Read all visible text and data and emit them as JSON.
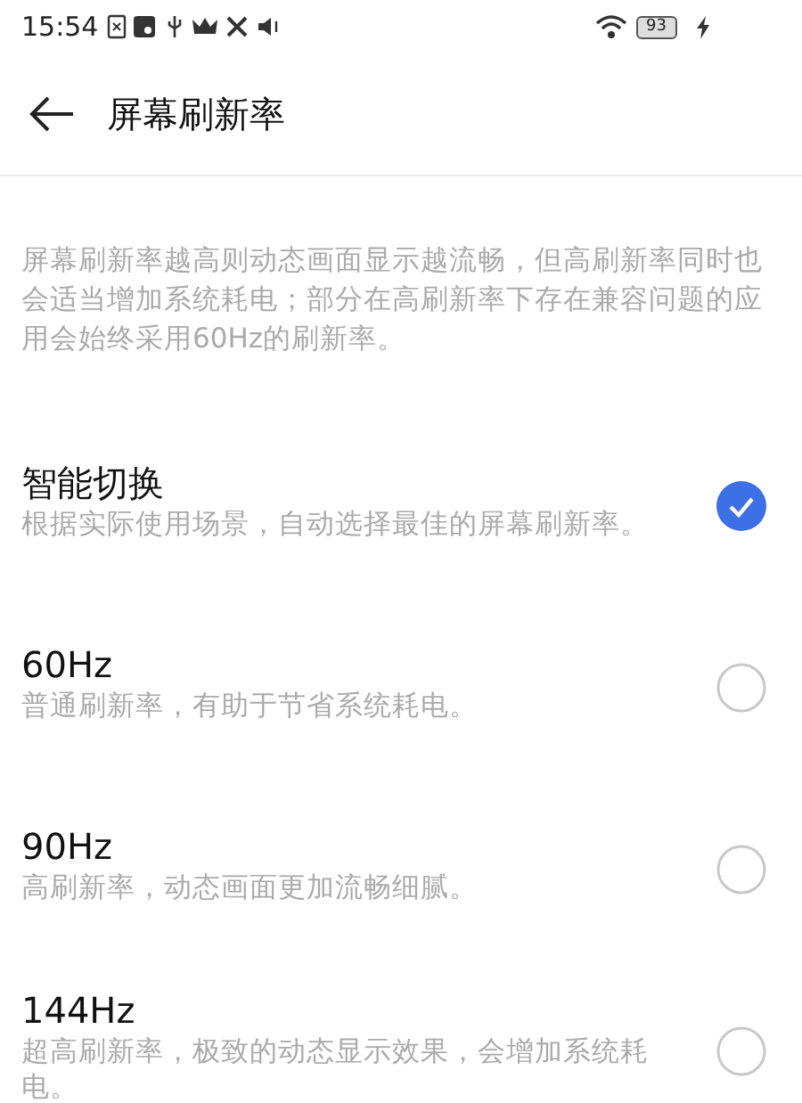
{
  "status_bar": {
    "time": "15:54",
    "battery": "93"
  },
  "header": {
    "title": "屏幕刷新率"
  },
  "description": "屏幕刷新率越高则动态画面显示越流畅，但高刷新率同时也会适当增加系统耗电；部分在高刷新率下存在兼容问题的应用会始终采用60Hz的刷新率。",
  "options": [
    {
      "title": "智能切换",
      "subtitle": "根据实际使用场景，自动选择最佳的屏幕刷新率。",
      "selected": true
    },
    {
      "title": "60Hz",
      "subtitle": "普通刷新率，有助于节省系统耗电。",
      "selected": false
    },
    {
      "title": "90Hz",
      "subtitle": "高刷新率，动态画面更加流畅细腻。",
      "selected": false
    },
    {
      "title": "144Hz",
      "subtitle": "超高刷新率，极致的动态显示效果，会增加系统耗电。",
      "selected": false
    }
  ]
}
